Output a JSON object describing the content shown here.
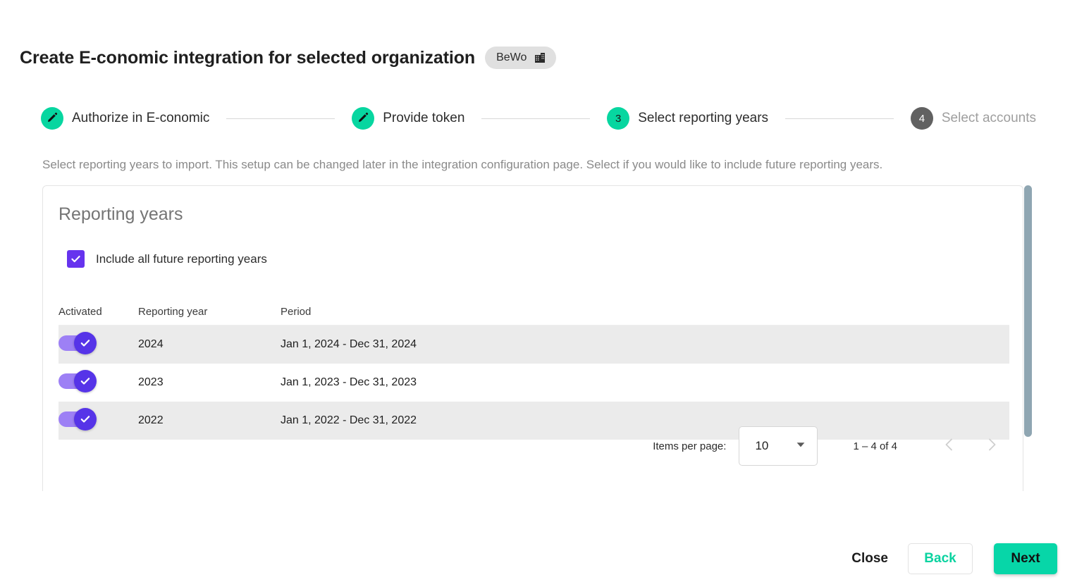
{
  "header": {
    "title": "Create E-conomic integration for selected organization",
    "org_badge": {
      "label": "BeWo",
      "icon": "building-icon"
    }
  },
  "stepper": {
    "steps": [
      {
        "index": "1",
        "label": "Authorize in E-conomic",
        "state": "done",
        "icon": "pencil-icon"
      },
      {
        "index": "2",
        "label": "Provide token",
        "state": "done",
        "icon": "pencil-icon"
      },
      {
        "index": "3",
        "label": "Select reporting years",
        "state": "active",
        "icon": ""
      },
      {
        "index": "4",
        "label": "Select accounts",
        "state": "inactive",
        "icon": ""
      }
    ]
  },
  "description": "Select reporting years to import. This setup can be changed later in the integration configuration page. Select if you would like to include future reporting years.",
  "card": {
    "title": "Reporting years",
    "future_checkbox": {
      "label": "Include all future reporting years",
      "checked": true
    }
  },
  "table": {
    "columns": [
      "Activated",
      "Reporting year",
      "Period"
    ],
    "rows": [
      {
        "activated": true,
        "year": "2024",
        "period": "Jan 1, 2024 - Dec 31, 2024"
      },
      {
        "activated": true,
        "year": "2023",
        "period": "Jan 1, 2023 - Dec 31, 2023"
      },
      {
        "activated": true,
        "year": "2022",
        "period": "Jan 1, 2022 - Dec 31, 2022"
      }
    ]
  },
  "paginator": {
    "items_per_page_label": "Items per page:",
    "items_per_page_value": "10",
    "range_label": "1 – 4 of 4",
    "prev_icon": "chevron-left-icon",
    "next_icon": "chevron-right-icon",
    "prev_enabled": false,
    "next_enabled": false
  },
  "footer": {
    "close_label": "Close",
    "back_label": "Back",
    "next_label": "Next"
  },
  "colors": {
    "accent_green": "#07d6a0",
    "accent_purple": "#6633ee",
    "toggle_track": "#9d80f5",
    "toggle_thumb": "#5634e8",
    "inactive_gray": "#616161",
    "row_stripe": "#ebebeb",
    "scrollbar": "#8fa6b2"
  }
}
